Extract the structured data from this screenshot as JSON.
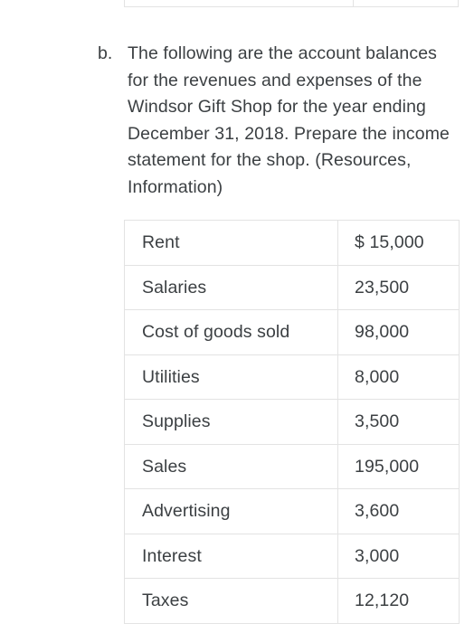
{
  "document": {
    "background_color": "#ffffff",
    "text_color": "#3c4043",
    "border_color": "#e3e3e3"
  },
  "question": {
    "marker": "b.",
    "text": "The following are the account balances for the revenues and expenses of the Windsor Gift Shop for the year ending December 31, 2018. Prepare the income statement for the shop. (Resources, Information)"
  },
  "balances_table": {
    "columns": [
      "account",
      "amount"
    ],
    "rows": [
      {
        "account": "Rent",
        "amount": "$ 15,000"
      },
      {
        "account": "Salaries",
        "amount": "23,500"
      },
      {
        "account": "Cost of goods sold",
        "amount": "98,000"
      },
      {
        "account": "Utilities",
        "amount": "8,000"
      },
      {
        "account": "Supplies",
        "amount": "3,500"
      },
      {
        "account": "Sales",
        "amount": "195,000"
      },
      {
        "account": "Advertising",
        "amount": "3,600"
      },
      {
        "account": "Interest",
        "amount": "3,000"
      },
      {
        "account": "Taxes",
        "amount": "12,120"
      }
    ]
  }
}
